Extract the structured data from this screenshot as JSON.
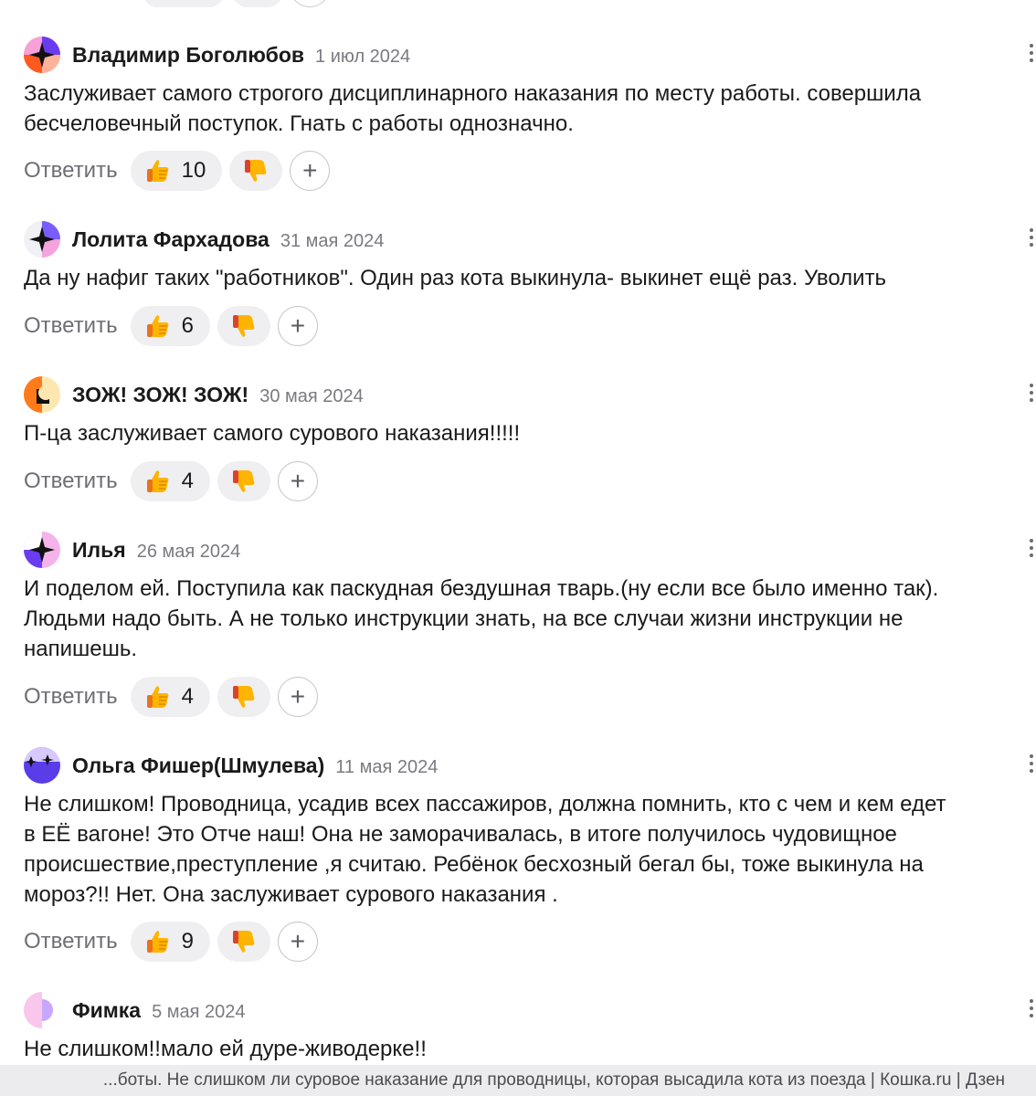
{
  "reply_label": "Ответить",
  "add_label": "+",
  "colors": {
    "accent": "#ffb400",
    "dislike_accent": "#d9432f",
    "muted": "#7a7a80"
  },
  "comments": [
    {
      "author": "Владимир Боголюбов",
      "date": "1 июл 2024",
      "lines": [
        "Заслуживает самого строгого дисциплинарного наказания по месту работы. совершила",
        "бесчеловечный поступок. Гнать с работы однозначно."
      ],
      "likes": "10"
    },
    {
      "author": "Лолита Фархадова",
      "date": "31 мая 2024",
      "lines": [
        "Да ну нафиг таких \"работников\". Один раз кота выкинула- выкинет ещё раз. Уволить"
      ],
      "likes": "6"
    },
    {
      "author": "ЗОЖ! ЗОЖ! ЗОЖ!",
      "date": "30 мая 2024",
      "lines": [
        "П-ца заслуживает самого сурового наказания!!!!!"
      ],
      "likes": "4"
    },
    {
      "author": "Илья",
      "date": "26 мая 2024",
      "lines": [
        "И поделом ей. Поступила как паскудная бездушная тварь.(ну если все было именно так).",
        "Людьми надо быть. А не только инструкции знать, на все случаи жизни инструкции не",
        "напишешь."
      ],
      "likes": "4"
    },
    {
      "author": "Ольга Фишер(Шмулева)",
      "date": "11 мая 2024",
      "lines": [
        "Не слишком! Проводница, усадив всех пассажиров, должна помнить, кто с чем и кем едет",
        "в ЕЁ вагоне! Это Отче наш! Она не заморачивалась, в итоге получилось чудовищное",
        "происшествие,преступление ,я считаю. Ребёнок бесхозный бегал бы, тоже выкинула на",
        "мороз?!! Нет. Она заслуживает сурового наказания ."
      ],
      "likes": "9"
    },
    {
      "author": "Фимка",
      "date": "5 мая 2024",
      "lines": [
        "Не слишком!!мало ей дуре-живодерке!!"
      ],
      "likes": ""
    }
  ],
  "footer": {
    "title": "...боты. Не слишком ли суровое наказание для проводницы, которая высадила кота из поезда | Кошка.ru | Дзен"
  }
}
